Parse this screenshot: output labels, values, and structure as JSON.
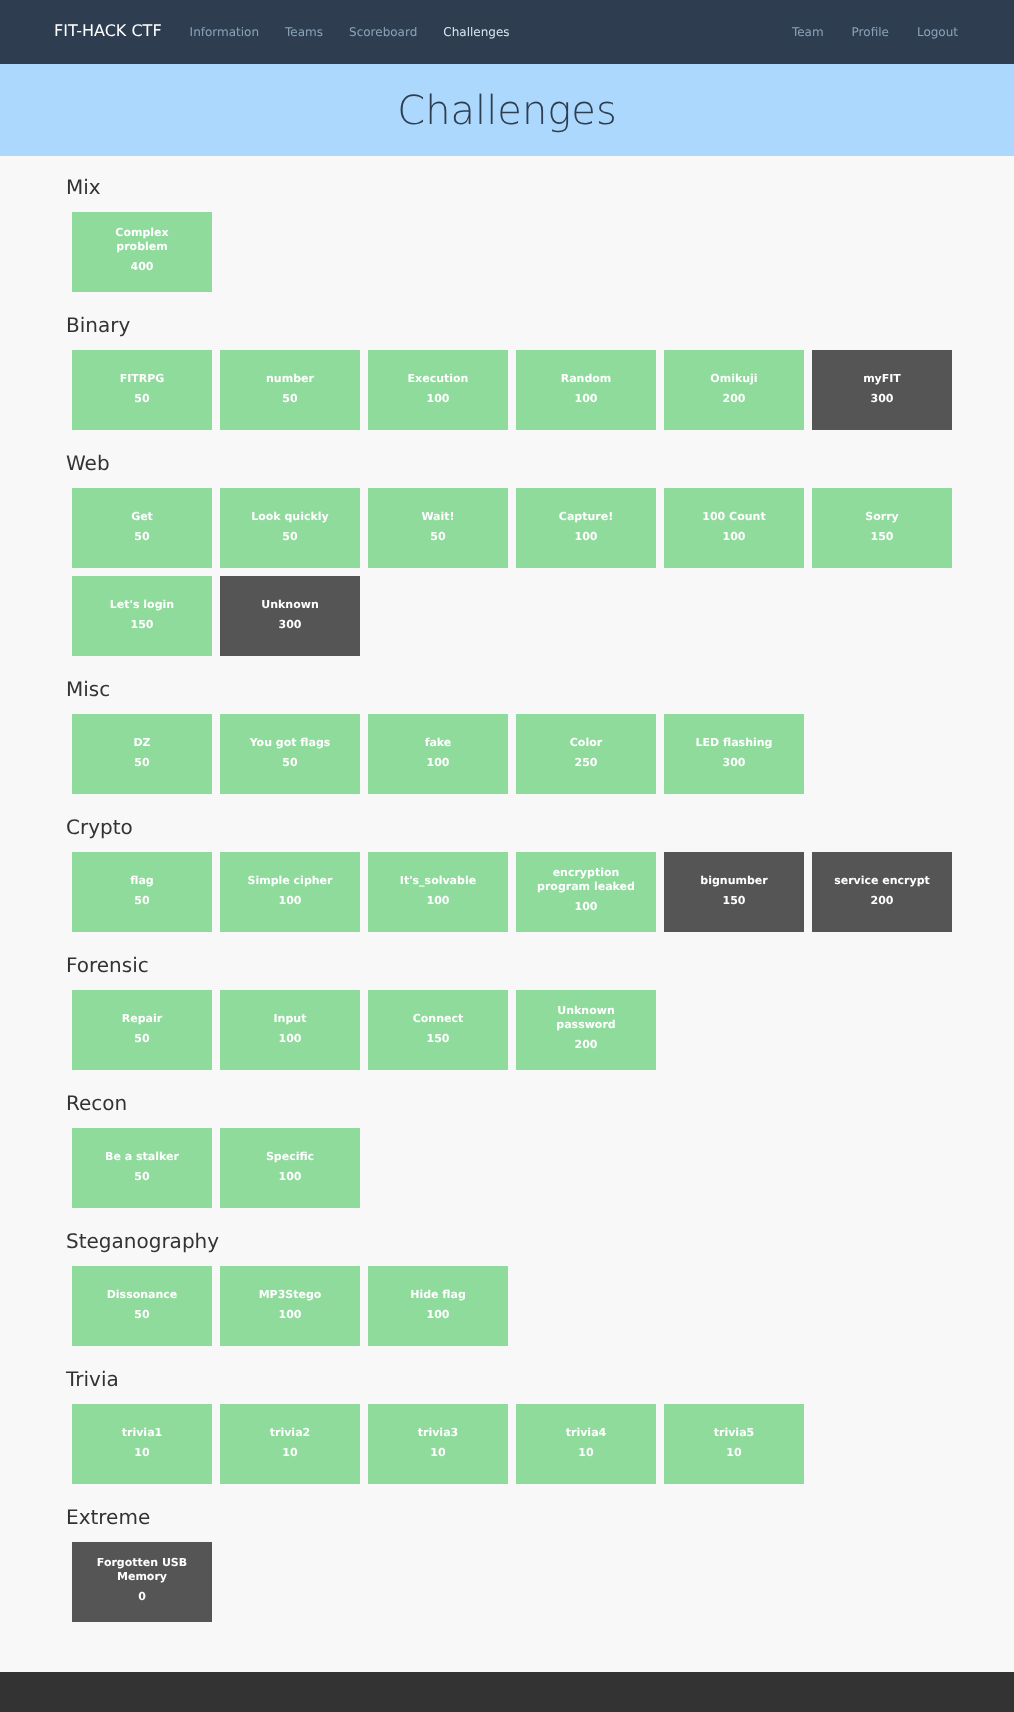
{
  "navbar": {
    "brand": "FIT-HACK CTF",
    "left_links": [
      {
        "label": "Information",
        "selected": false
      },
      {
        "label": "Teams",
        "selected": false
      },
      {
        "label": "Scoreboard",
        "selected": false
      },
      {
        "label": "Challenges",
        "selected": true
      }
    ],
    "right_links": [
      "Team",
      "Profile",
      "Logout"
    ]
  },
  "page_title": "Challenges",
  "categories": [
    {
      "name": "Mix",
      "challenges": [
        {
          "name": "Complex problem",
          "points": "400",
          "solved": true
        }
      ]
    },
    {
      "name": "Binary",
      "challenges": [
        {
          "name": "FITRPG",
          "points": "50",
          "solved": true
        },
        {
          "name": "number",
          "points": "50",
          "solved": true
        },
        {
          "name": "Execution",
          "points": "100",
          "solved": true
        },
        {
          "name": "Random",
          "points": "100",
          "solved": true
        },
        {
          "name": "Omikuji",
          "points": "200",
          "solved": true
        },
        {
          "name": "myFIT",
          "points": "300",
          "solved": false
        }
      ]
    },
    {
      "name": "Web",
      "challenges": [
        {
          "name": "Get",
          "points": "50",
          "solved": true
        },
        {
          "name": "Look quickly",
          "points": "50",
          "solved": true
        },
        {
          "name": "Wait!",
          "points": "50",
          "solved": true
        },
        {
          "name": "Capture!",
          "points": "100",
          "solved": true
        },
        {
          "name": "100 Count",
          "points": "100",
          "solved": true
        },
        {
          "name": "Sorry",
          "points": "150",
          "solved": true
        },
        {
          "name": "Let's login",
          "points": "150",
          "solved": true
        },
        {
          "name": "Unknown",
          "points": "300",
          "solved": false
        }
      ]
    },
    {
      "name": "Misc",
      "challenges": [
        {
          "name": "DZ",
          "points": "50",
          "solved": true
        },
        {
          "name": "You got flags",
          "points": "50",
          "solved": true
        },
        {
          "name": "fake",
          "points": "100",
          "solved": true
        },
        {
          "name": "Color",
          "points": "250",
          "solved": true
        },
        {
          "name": "LED flashing",
          "points": "300",
          "solved": true
        }
      ]
    },
    {
      "name": "Crypto",
      "challenges": [
        {
          "name": "flag",
          "points": "50",
          "solved": true
        },
        {
          "name": "Simple cipher",
          "points": "100",
          "solved": true
        },
        {
          "name": "It's_solvable",
          "points": "100",
          "solved": true
        },
        {
          "name": "encryption program leaked",
          "points": "100",
          "solved": true
        },
        {
          "name": "bignumber",
          "points": "150",
          "solved": false
        },
        {
          "name": "service encrypt",
          "points": "200",
          "solved": false
        }
      ]
    },
    {
      "name": "Forensic",
      "challenges": [
        {
          "name": "Repair",
          "points": "50",
          "solved": true
        },
        {
          "name": "Input",
          "points": "100",
          "solved": true
        },
        {
          "name": "Connect",
          "points": "150",
          "solved": true
        },
        {
          "name": "Unknown password",
          "points": "200",
          "solved": true
        }
      ]
    },
    {
      "name": "Recon",
      "challenges": [
        {
          "name": "Be a stalker",
          "points": "50",
          "solved": true
        },
        {
          "name": "Specific",
          "points": "100",
          "solved": true
        }
      ]
    },
    {
      "name": "Steganography",
      "challenges": [
        {
          "name": "Dissonance",
          "points": "50",
          "solved": true
        },
        {
          "name": "MP3Stego",
          "points": "100",
          "solved": true
        },
        {
          "name": "Hide flag",
          "points": "100",
          "solved": true
        }
      ]
    },
    {
      "name": "Trivia",
      "challenges": [
        {
          "name": "trivia1",
          "points": "10",
          "solved": true
        },
        {
          "name": "trivia2",
          "points": "10",
          "solved": true
        },
        {
          "name": "trivia3",
          "points": "10",
          "solved": true
        },
        {
          "name": "trivia4",
          "points": "10",
          "solved": true
        },
        {
          "name": "trivia5",
          "points": "10",
          "solved": true
        }
      ]
    },
    {
      "name": "Extreme",
      "challenges": [
        {
          "name": "Forgotten USB Memory",
          "points": "0",
          "solved": false
        }
      ]
    }
  ]
}
